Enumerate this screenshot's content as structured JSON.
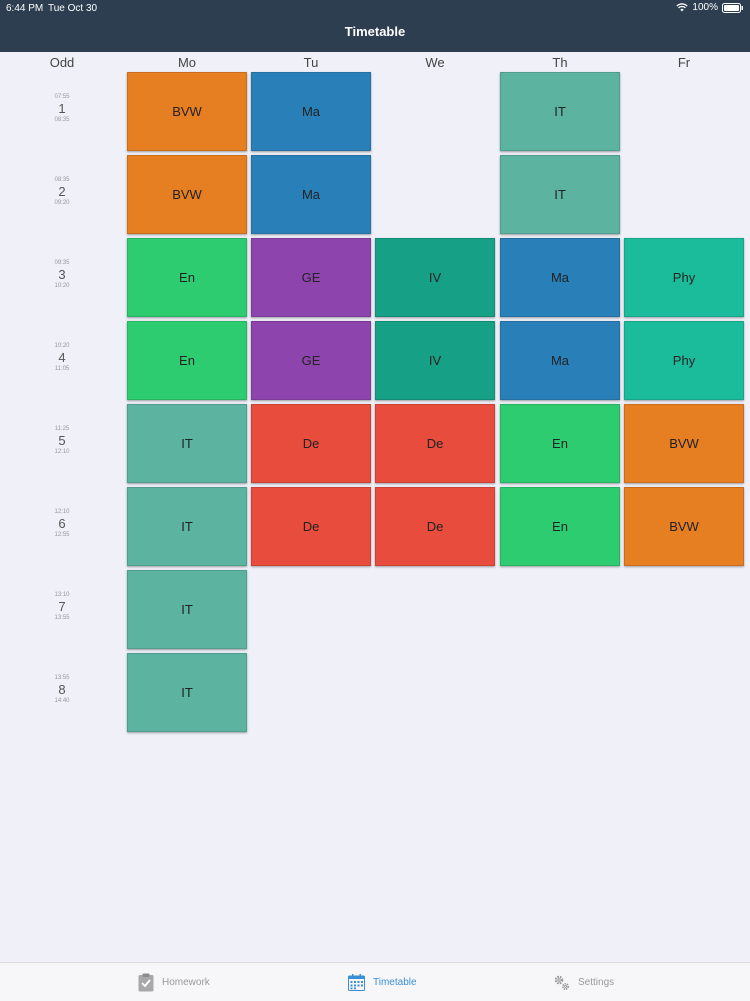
{
  "status_bar": {
    "time": "6:44 PM",
    "date": "Tue Oct 30",
    "battery": "100%"
  },
  "nav": {
    "title": "Timetable"
  },
  "grid": {
    "week_label": "Odd",
    "days": [
      "Mo",
      "Tu",
      "We",
      "Th",
      "Fr"
    ],
    "periods": [
      {
        "number": "1",
        "start": "07:55",
        "end": "08:35"
      },
      {
        "number": "2",
        "start": "08:35",
        "end": "09:20"
      },
      {
        "number": "3",
        "start": "09:35",
        "end": "10:20"
      },
      {
        "number": "4",
        "start": "10:20",
        "end": "11:05"
      },
      {
        "number": "5",
        "start": "11:25",
        "end": "12:10"
      },
      {
        "number": "6",
        "start": "12:10",
        "end": "12:55"
      },
      {
        "number": "7",
        "start": "13:10",
        "end": "13:55"
      },
      {
        "number": "8",
        "start": "13:55",
        "end": "14:40"
      }
    ],
    "lessons": [
      {
        "day": 0,
        "period": 0,
        "subject": "BVW",
        "color": "#e67e22"
      },
      {
        "day": 1,
        "period": 0,
        "subject": "Ma",
        "color": "#2980b9"
      },
      {
        "day": 3,
        "period": 0,
        "subject": "IT",
        "color": "#5cb3a0"
      },
      {
        "day": 0,
        "period": 1,
        "subject": "BVW",
        "color": "#e67e22"
      },
      {
        "day": 1,
        "period": 1,
        "subject": "Ma",
        "color": "#2980b9"
      },
      {
        "day": 3,
        "period": 1,
        "subject": "IT",
        "color": "#5cb3a0"
      },
      {
        "day": 0,
        "period": 2,
        "subject": "En",
        "color": "#2ecc71"
      },
      {
        "day": 1,
        "period": 2,
        "subject": "GE",
        "color": "#8e44ad"
      },
      {
        "day": 2,
        "period": 2,
        "subject": "IV",
        "color": "#16a085"
      },
      {
        "day": 3,
        "period": 2,
        "subject": "Ma",
        "color": "#2980b9"
      },
      {
        "day": 4,
        "period": 2,
        "subject": "Phy",
        "color": "#1abc9c"
      },
      {
        "day": 0,
        "period": 3,
        "subject": "En",
        "color": "#2ecc71"
      },
      {
        "day": 1,
        "period": 3,
        "subject": "GE",
        "color": "#8e44ad"
      },
      {
        "day": 2,
        "period": 3,
        "subject": "IV",
        "color": "#16a085"
      },
      {
        "day": 3,
        "period": 3,
        "subject": "Ma",
        "color": "#2980b9"
      },
      {
        "day": 4,
        "period": 3,
        "subject": "Phy",
        "color": "#1abc9c"
      },
      {
        "day": 0,
        "period": 4,
        "subject": "IT",
        "color": "#5cb3a0"
      },
      {
        "day": 1,
        "period": 4,
        "subject": "De",
        "color": "#e74c3c"
      },
      {
        "day": 2,
        "period": 4,
        "subject": "De",
        "color": "#e74c3c"
      },
      {
        "day": 3,
        "period": 4,
        "subject": "En",
        "color": "#2ecc71"
      },
      {
        "day": 4,
        "period": 4,
        "subject": "BVW",
        "color": "#e67e22"
      },
      {
        "day": 0,
        "period": 5,
        "subject": "IT",
        "color": "#5cb3a0"
      },
      {
        "day": 1,
        "period": 5,
        "subject": "De",
        "color": "#e74c3c"
      },
      {
        "day": 2,
        "period": 5,
        "subject": "De",
        "color": "#e74c3c"
      },
      {
        "day": 3,
        "period": 5,
        "subject": "En",
        "color": "#2ecc71"
      },
      {
        "day": 4,
        "period": 5,
        "subject": "BVW",
        "color": "#e67e22"
      },
      {
        "day": 0,
        "period": 6,
        "subject": "IT",
        "color": "#5cb3a0"
      },
      {
        "day": 0,
        "period": 7,
        "subject": "IT",
        "color": "#5cb3a0"
      }
    ]
  },
  "tabbar": {
    "homework_label": "Homework",
    "homework_icon": "clipboard-check-icon",
    "timetable_label": "Timetable",
    "timetable_icon": "calendar-icon",
    "settings_label": "Settings",
    "settings_icon": "gears-icon",
    "active_color": "#3a8fd6",
    "inactive_color": "#999999"
  }
}
